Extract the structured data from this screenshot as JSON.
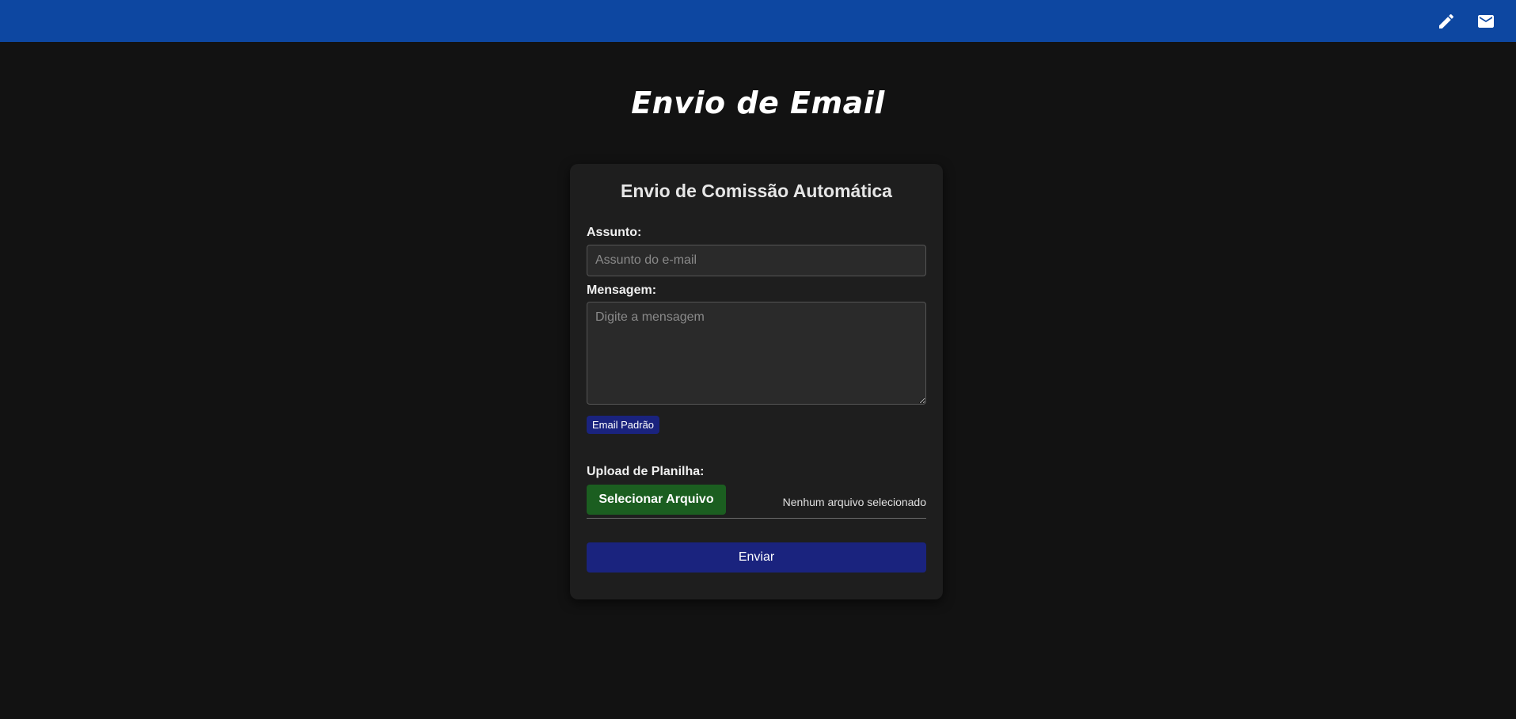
{
  "header": {
    "icons": [
      "edit-pencil-icon",
      "mail-icon"
    ],
    "background_color": "#0d47a1"
  },
  "page": {
    "title": "Envio de Email",
    "background_color": "#121212"
  },
  "form": {
    "title": "Envio de Comissão Automática",
    "subject": {
      "label": "Assunto:",
      "value": "",
      "placeholder": "Assunto do e-mail"
    },
    "message": {
      "label": "Mensagem:",
      "value": "",
      "placeholder": "Digite a mensagem"
    },
    "default_email_button": "Email Padrão",
    "upload": {
      "label": "Upload de Planilha:",
      "button": "Selecionar Arquivo",
      "status": "Nenhum arquivo selecionado"
    },
    "submit_button": "Enviar",
    "colors": {
      "primary_button": "#1a237e",
      "upload_button": "#1b5e20",
      "card": "#1e1e1e"
    }
  }
}
